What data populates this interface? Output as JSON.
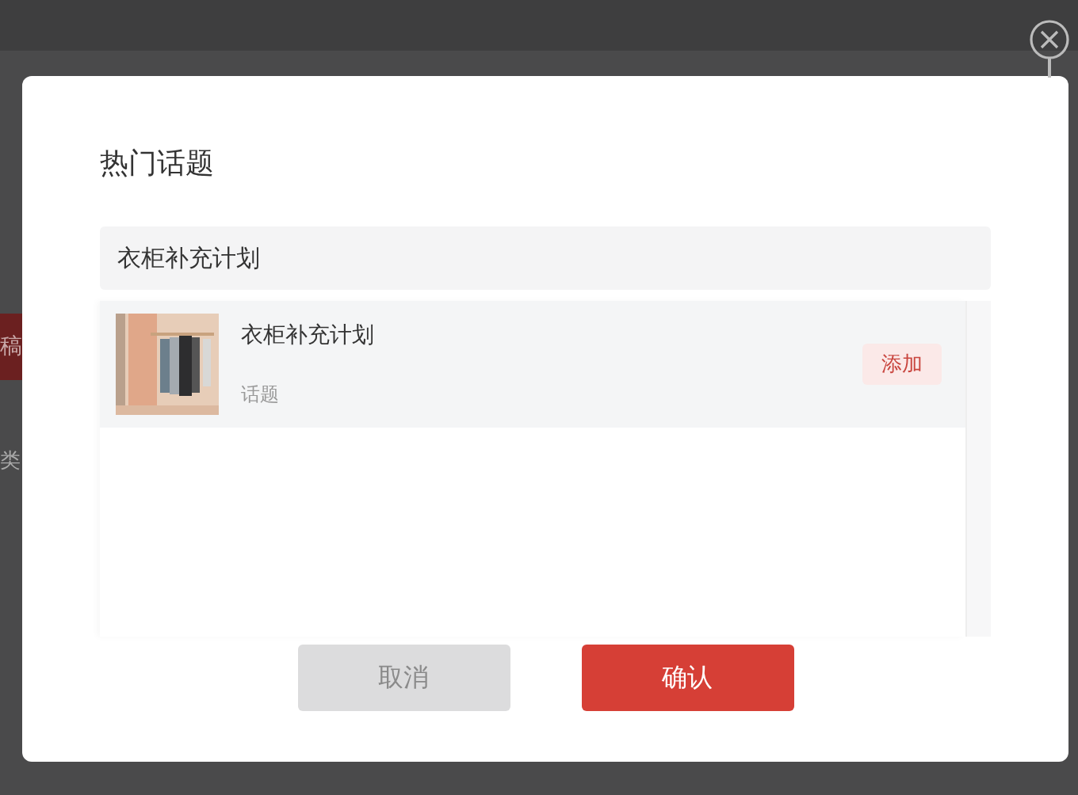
{
  "background": {
    "fragments": [
      {
        "text": "稿",
        "kind": "button"
      },
      {
        "text": "类",
        "kind": "label"
      }
    ]
  },
  "dialog": {
    "title": "热门话题",
    "search": {
      "value": "衣柜补充计划"
    },
    "results": [
      {
        "title": "衣柜补充计划",
        "subtitle": "话题",
        "action": "添加"
      }
    ],
    "buttons": [
      {
        "label": "取消",
        "kind": "secondary"
      },
      {
        "label": "确认",
        "kind": "primary"
      }
    ]
  }
}
